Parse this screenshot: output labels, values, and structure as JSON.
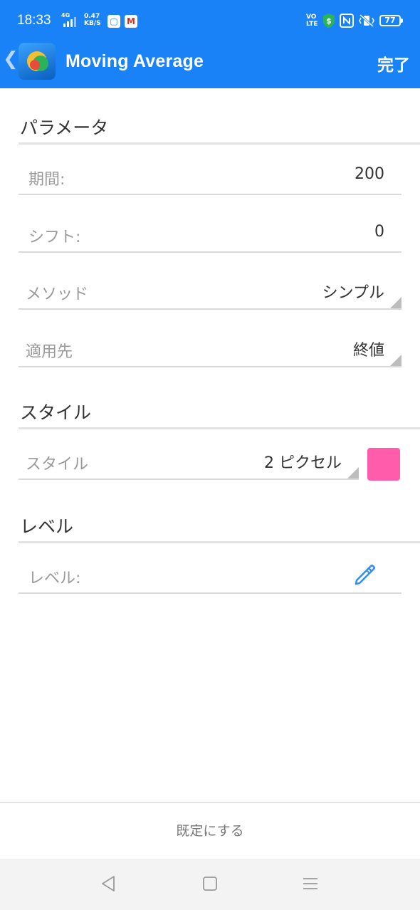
{
  "status_bar": {
    "time": "18:33",
    "network": "4G",
    "speed_value": "0.47",
    "speed_unit": "KB/S",
    "volte_top": "VO",
    "volte_bottom": "LTE",
    "battery": "77",
    "icons": [
      "signal-icon",
      "notes-app-icon",
      "gmail-icon",
      "dollar-shield-icon",
      "nfc-icon",
      "vibrate-icon",
      "battery-icon"
    ]
  },
  "app_bar": {
    "back_label": "❮",
    "title": "Moving Average",
    "done_label": "完了"
  },
  "sections": {
    "params_title": "パラメータ",
    "style_title": "スタイル",
    "level_title": "レベル"
  },
  "params": {
    "period": {
      "label": "期間:",
      "value": "200"
    },
    "shift": {
      "label": "シフト:",
      "value": "0"
    },
    "method": {
      "label": "メソッド",
      "value": "シンプル"
    },
    "apply_to": {
      "label": "適用先",
      "value": "終値"
    }
  },
  "style": {
    "label": "スタイル",
    "value": "2 ピクセル",
    "color": "#ff5cac"
  },
  "level": {
    "label": "レベル:"
  },
  "footer": {
    "reset_label": "既定にする"
  },
  "colors": {
    "accent": "#1a82f7"
  }
}
